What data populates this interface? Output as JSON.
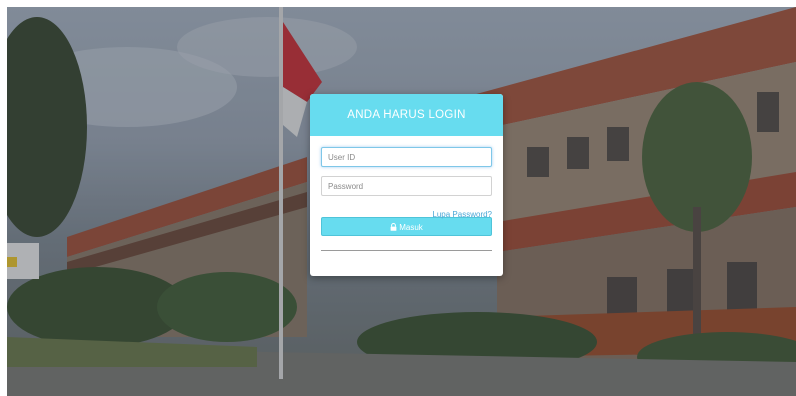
{
  "login": {
    "title": "ANDA HARUS LOGIN",
    "user_id_placeholder": "User ID",
    "password_placeholder": "Password",
    "forgot_label": "Lupa Password?",
    "submit_label": "Masuk",
    "submit_icon": "lock-icon"
  },
  "colors": {
    "accent": "#67dcef",
    "link": "#4aa7d6",
    "header_text": "#ffffff"
  }
}
